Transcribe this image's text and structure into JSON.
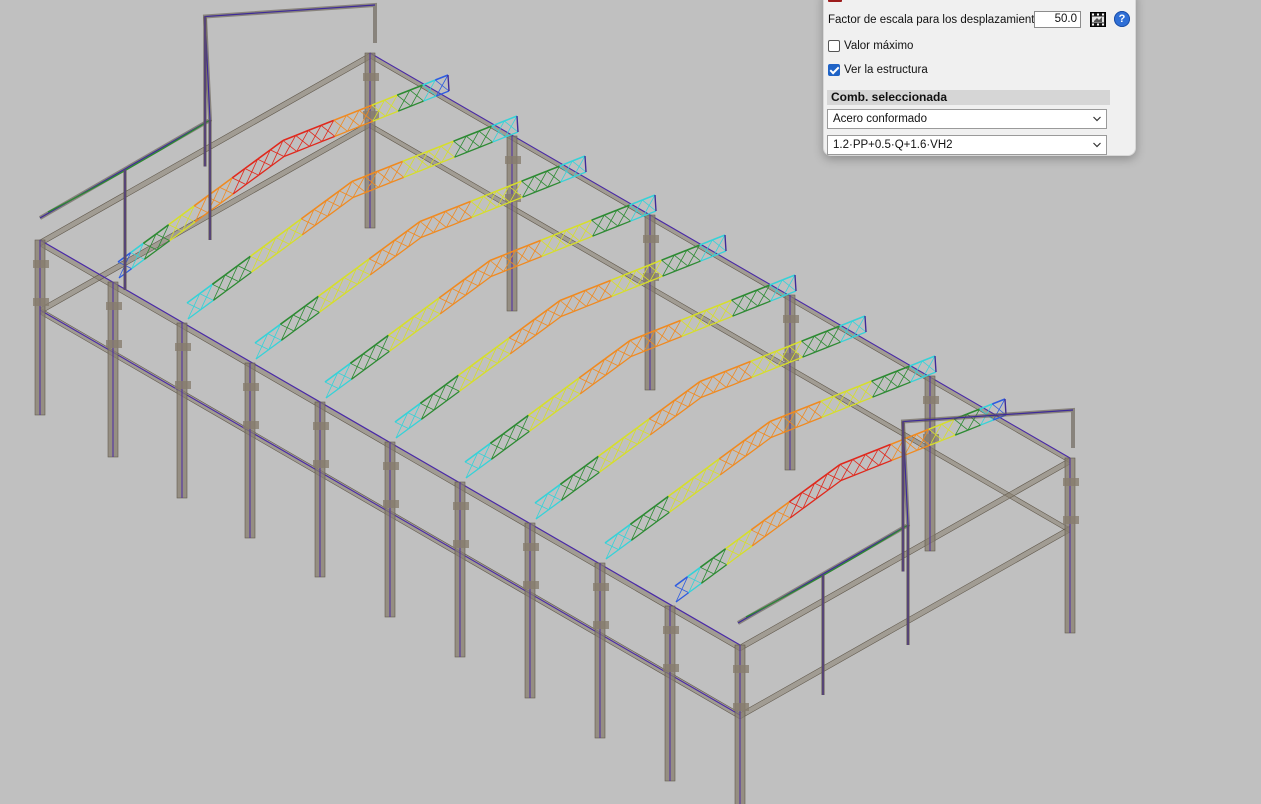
{
  "scene": {
    "description_icon": "3d-structure-view",
    "colors": {
      "background": "#c0c0c0",
      "member_fill": "#877d6e",
      "member_stroke": "#625a4e",
      "frame_line": "#4a2aa8",
      "truss_chord": "#3e2a99",
      "deform_red": "#e0281c",
      "deform_orange": "#f08a20",
      "deform_yellow": "#d6de2a",
      "deform_green": "#2c8a32",
      "deform_cyan": "#35d2d8",
      "deform_blue": "#2e5ce0"
    }
  },
  "panel": {
    "scale_label": "Factor de escala para los desplazamientos",
    "scale_value": "50.0",
    "film_icon": "film-strip-icon",
    "help_icon": "help-icon",
    "help_glyph": "?",
    "max_value_label": "Valor máximo",
    "max_value_checked": false,
    "show_structure_label": "Ver la estructura",
    "show_structure_checked": true,
    "section_title": "Comb. seleccionada",
    "material_select": "Acero conformado",
    "combination_select": "1.2·PP+0.5·Q+1.6·VH2"
  }
}
